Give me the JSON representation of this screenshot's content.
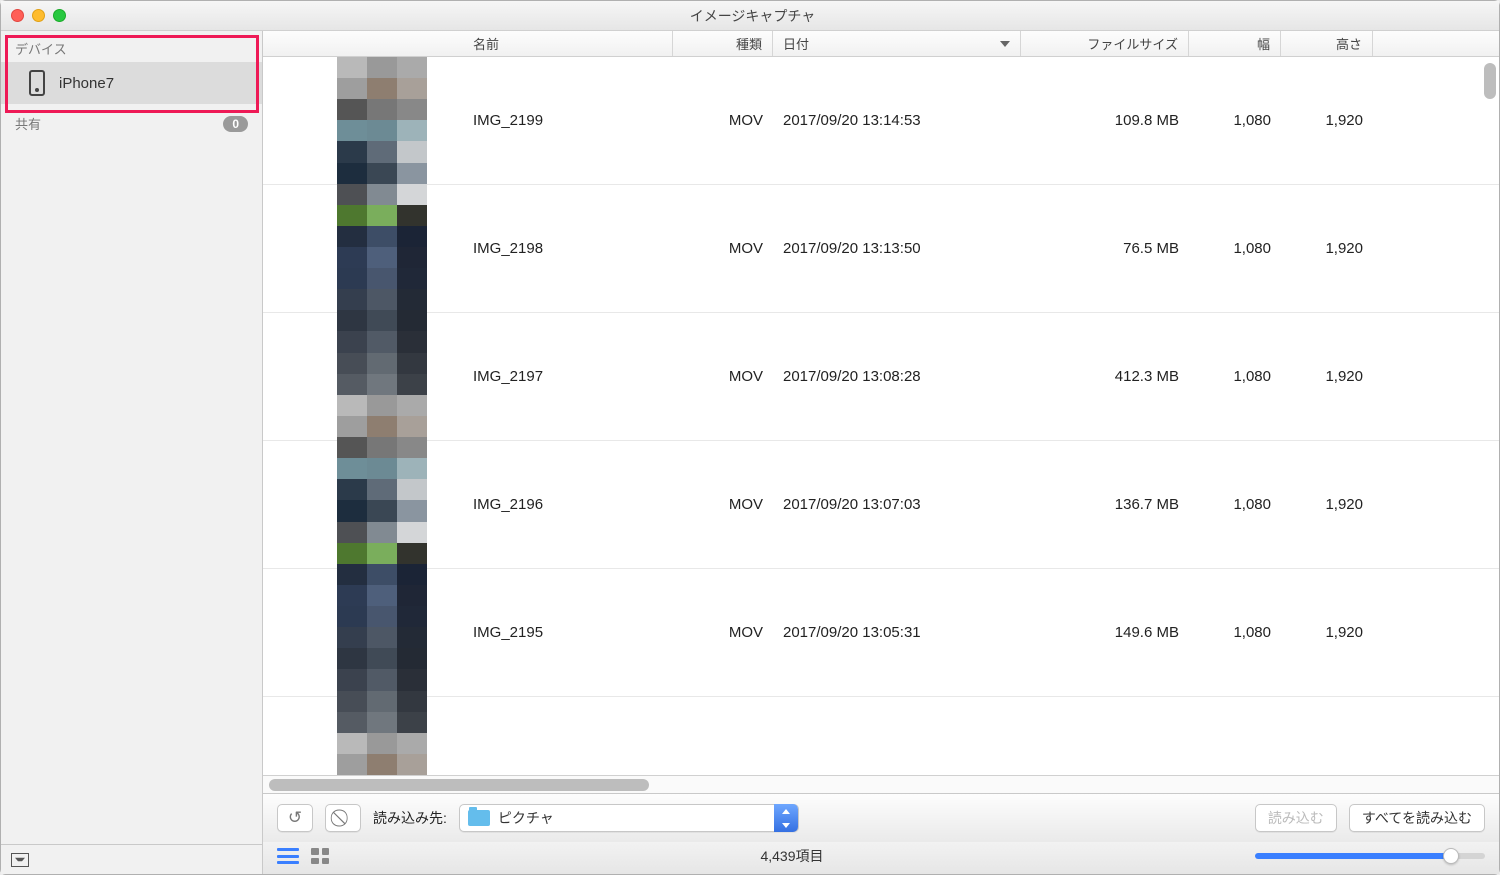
{
  "window": {
    "title": "イメージキャプチャ"
  },
  "sidebar": {
    "devices_label": "デバイス",
    "device_name": "iPhone7",
    "share_label": "共有",
    "share_count": "0"
  },
  "columns": {
    "name": "名前",
    "kind": "種類",
    "date": "日付",
    "size": "ファイルサイズ",
    "width": "幅",
    "height": "高さ"
  },
  "files": [
    {
      "name": "IMG_2199",
      "kind": "MOV",
      "date": "2017/09/20 13:14:53",
      "size": "109.8 MB",
      "width": "1,080",
      "height": "1,920"
    },
    {
      "name": "IMG_2198",
      "kind": "MOV",
      "date": "2017/09/20 13:13:50",
      "size": "76.5 MB",
      "width": "1,080",
      "height": "1,920"
    },
    {
      "name": "IMG_2197",
      "kind": "MOV",
      "date": "2017/09/20 13:08:28",
      "size": "412.3 MB",
      "width": "1,080",
      "height": "1,920"
    },
    {
      "name": "IMG_2196",
      "kind": "MOV",
      "date": "2017/09/20 13:07:03",
      "size": "136.7 MB",
      "width": "1,080",
      "height": "1,920"
    },
    {
      "name": "IMG_2195",
      "kind": "MOV",
      "date": "2017/09/20 13:05:31",
      "size": "149.6 MB",
      "width": "1,080",
      "height": "1,920"
    }
  ],
  "toolbar": {
    "import_to_label": "読み込み先:",
    "destination": "ピクチャ",
    "import_button": "読み込む",
    "import_all_button": "すべてを読み込む"
  },
  "statusbar": {
    "item_count": "4,439項目"
  },
  "thumbnail_colors": [
    [
      "#b9b9b9",
      "#999",
      "#aaa",
      "#9e9e9e",
      "#8e7e70",
      "#a8a099",
      "#555",
      "#777",
      "#888",
      "#6e8e98",
      "#6c8a94",
      "#9db3b9",
      "#2b3a4a",
      "#5f6b78",
      "#c3c7ca",
      "#1d2d3e",
      "#3a4754",
      "#8a95a0",
      "#4e5054",
      "#818a92",
      "#d4d6d8",
      "#4e782f",
      "#7aae5c",
      "#32332d"
    ],
    [
      "#232e40",
      "#3d4d66",
      "#1b2436",
      "#2d3b54",
      "#4e5f7b",
      "#1f2636",
      "#2c3a52",
      "#48566e",
      "#202838",
      "#343e4e",
      "#4d5765",
      "#232a36",
      "#2e3642",
      "#404a56",
      "#242a34",
      "#3b424e",
      "#515a66",
      "#2a2f38",
      "#474d56",
      "#626a72",
      "#333840",
      "#555b63",
      "#70777e",
      "#3c4148"
    ]
  ]
}
